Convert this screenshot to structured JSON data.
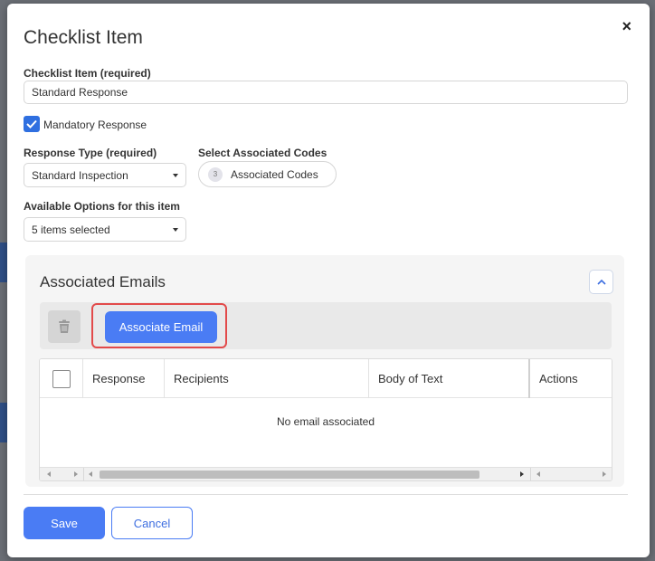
{
  "dialog": {
    "title": "Checklist Item",
    "close_glyph": "×"
  },
  "checklist_item": {
    "label": "Checklist Item (required)",
    "value": "Standard Response"
  },
  "mandatory": {
    "label": "Mandatory Response",
    "checked": true
  },
  "response_type": {
    "label": "Response Type (required)",
    "value": "Standard Inspection"
  },
  "associated_codes": {
    "label": "Select Associated Codes",
    "count": "3",
    "value": "Associated Codes"
  },
  "available_options": {
    "label": "Available Options for this item",
    "value": "5 items selected"
  },
  "emails": {
    "title": "Associated Emails",
    "associate_label": "Associate Email",
    "columns": [
      "Response",
      "Recipients",
      "Body of Text",
      "Actions"
    ],
    "empty_text": "No email associated"
  },
  "footer": {
    "save_label": "Save",
    "cancel_label": "Cancel"
  },
  "colors": {
    "accent": "#4a7cf4",
    "highlight": "#e24a4a"
  }
}
